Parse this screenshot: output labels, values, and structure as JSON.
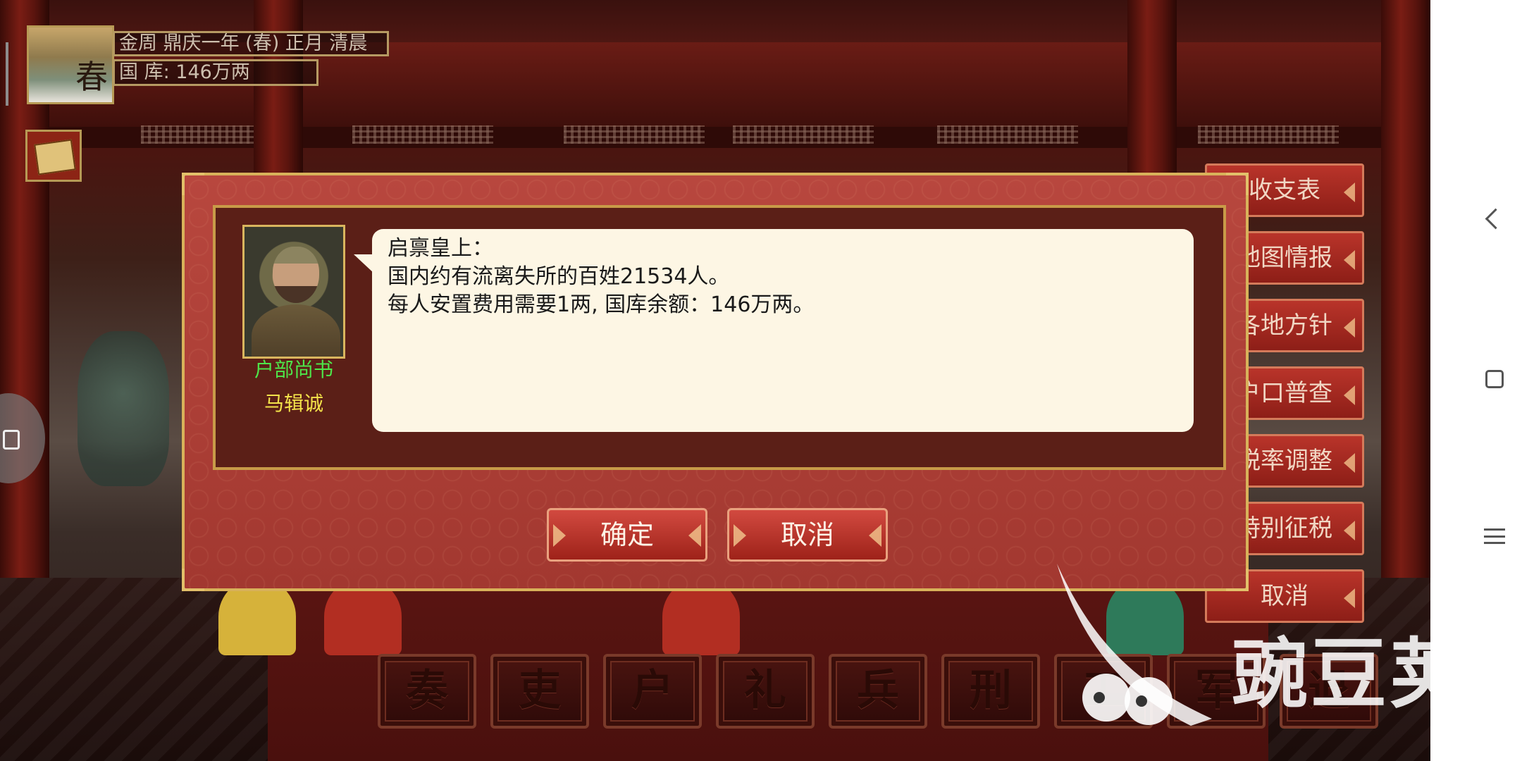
{
  "status": {
    "season_char": "春",
    "date_text": "金周 鼎庆一年 (春) 正月 清晨",
    "treasury_text": "国 库: 146万两"
  },
  "right_menu": {
    "items": [
      {
        "label": "收支表"
      },
      {
        "label": "地图情报"
      },
      {
        "label": "各地方针"
      },
      {
        "label": "户口普查"
      },
      {
        "label": "税率调整"
      },
      {
        "label": "特别征税"
      },
      {
        "label": "取消"
      }
    ]
  },
  "departments": [
    {
      "label": "奏"
    },
    {
      "label": "吏"
    },
    {
      "label": "户"
    },
    {
      "label": "礼"
    },
    {
      "label": "兵"
    },
    {
      "label": "刑"
    },
    {
      "label": "工"
    },
    {
      "label": "军"
    },
    {
      "label": "退"
    }
  ],
  "dialog": {
    "speaker_title": "户部尚书",
    "speaker_name": "马辑诚",
    "message_lines": [
      "启禀皇上：",
      "国内约有流离失所的百姓21534人。",
      "每人安置费用需要1两, 国库余额：146万两。"
    ],
    "confirm_label": "确定",
    "cancel_label": "取消"
  },
  "watermark": {
    "text": "豌豆荚"
  },
  "colors": {
    "dialog_bg": "#a23830",
    "gold_border": "#d8b25a",
    "title_green": "#4ee64a",
    "name_yellow": "#f2e24a",
    "bubble_bg": "#fdf6e4"
  }
}
